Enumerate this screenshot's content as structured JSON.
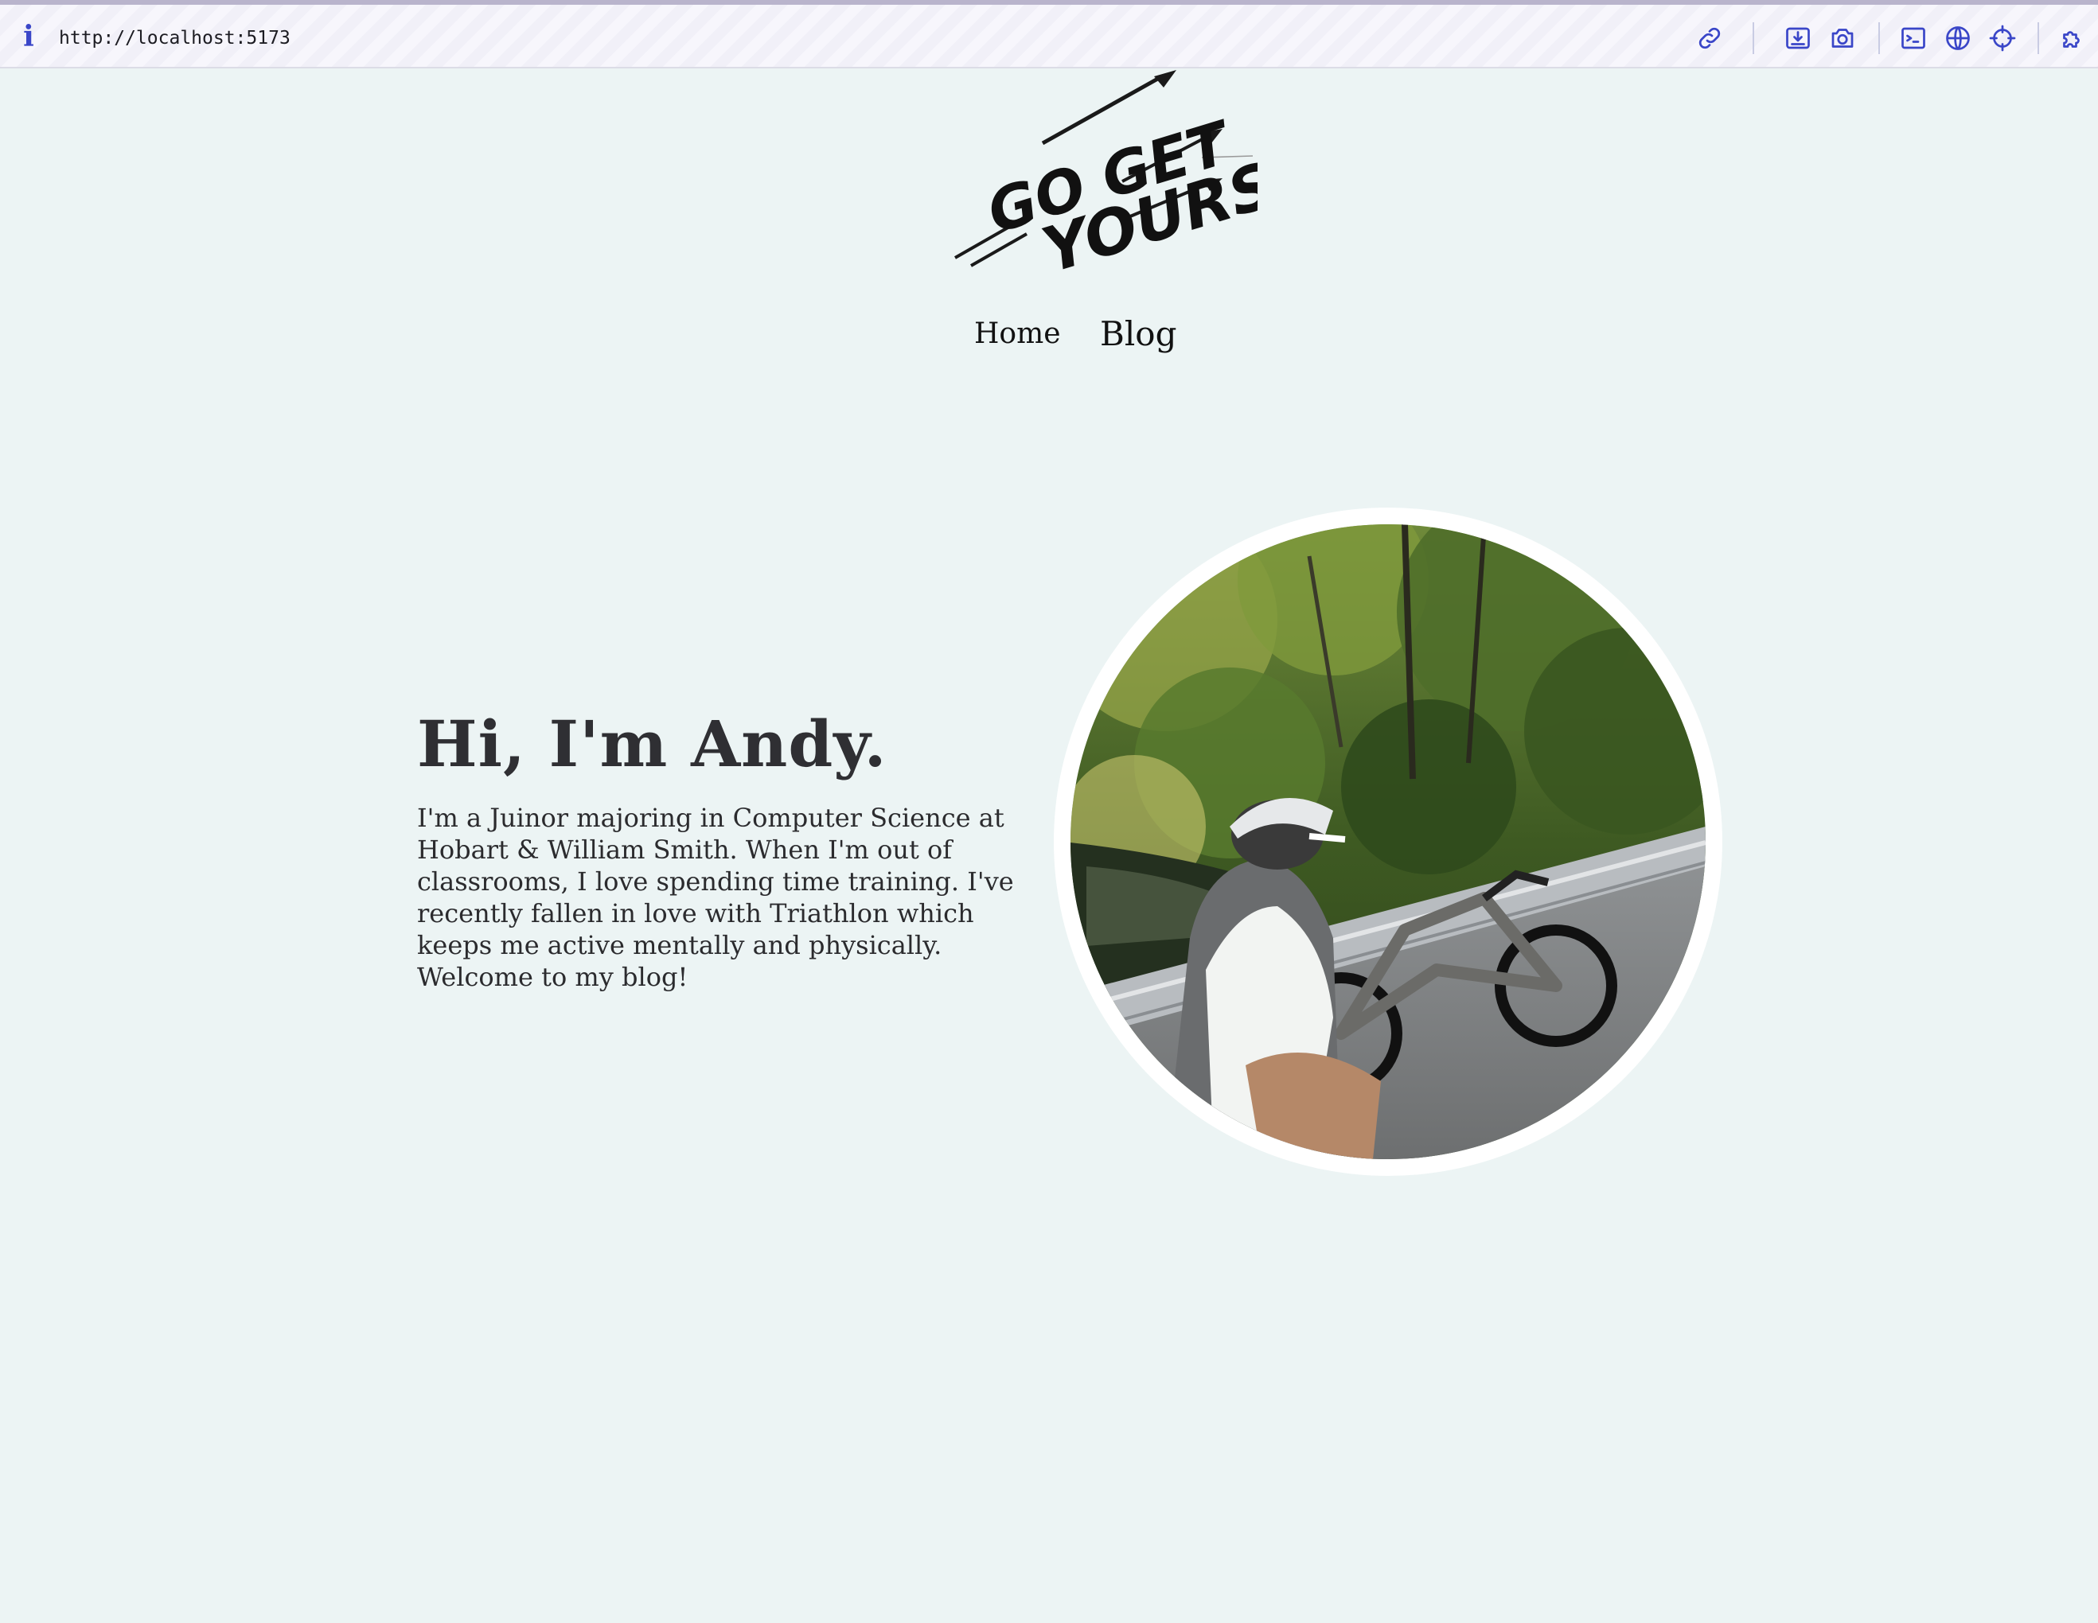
{
  "browser": {
    "url": "http://localhost:5173",
    "toolbar_icons": [
      "link-icon",
      "download-screenshot-icon",
      "camera-icon",
      "terminal-icon",
      "globe-icon",
      "crosshair-icon",
      "extension-icon"
    ]
  },
  "logo": {
    "text_line1": "GO GET",
    "text_line2": "YOURS"
  },
  "nav": {
    "items": [
      {
        "label": "Home"
      },
      {
        "label": "Blog"
      }
    ]
  },
  "hero": {
    "heading": "Hi, I'm Andy.",
    "bio": "I'm a Juinor majoring in Computer Science at Hobart & William Smith. When I'm out of classrooms, I love spending time training. I've recently fallen in love with Triathlon which keeps me active mentally and physically. Welcome to my blog!"
  },
  "colors": {
    "page_background": "#ecf4f4",
    "toolbar_accent": "#3a46c8",
    "text": "#2f2f33"
  }
}
